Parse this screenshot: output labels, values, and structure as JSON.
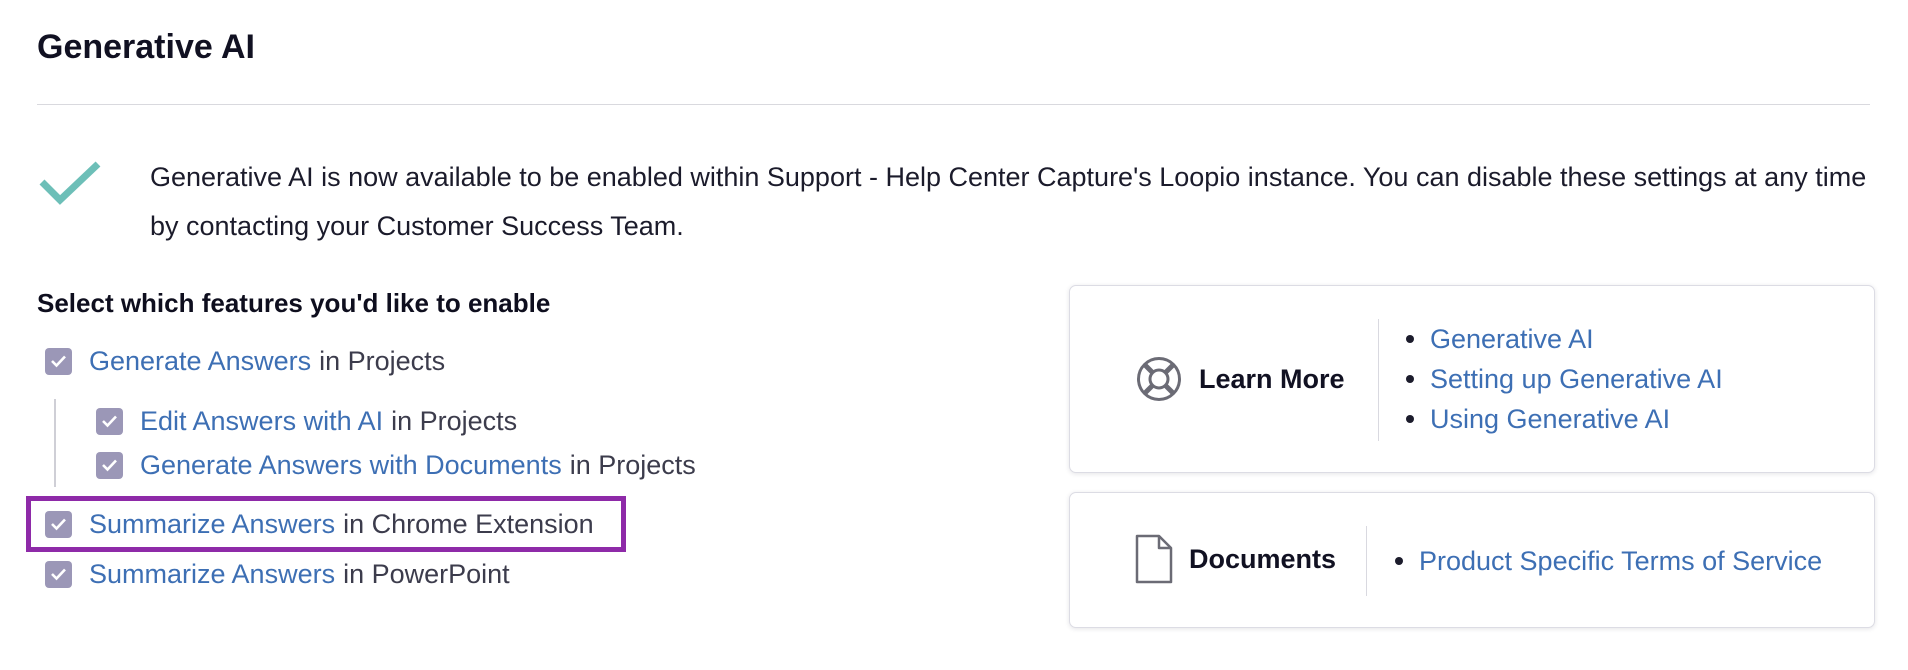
{
  "page": {
    "title": "Generative AI",
    "notice": "Generative AI is now available to be enabled within Support - Help Center Capture's Loopio instance. You can disable these settings at any time by contacting your Customer Success Team."
  },
  "features": {
    "title": "Select which features you'd like to enable",
    "items": [
      {
        "link": "Generate Answers",
        "context": "in Projects",
        "checked": true
      },
      {
        "link": "Edit Answers with AI",
        "context": "in Projects",
        "checked": true
      },
      {
        "link": "Generate Answers with Documents",
        "context": "in Projects",
        "checked": true
      },
      {
        "link": "Summarize Answers",
        "context": "in Chrome Extension",
        "checked": true
      },
      {
        "link": "Summarize Answers",
        "context": "in PowerPoint",
        "checked": true
      }
    ]
  },
  "learn_more": {
    "title": "Learn More",
    "icon": "lifebuoy-icon",
    "links": [
      "Generative AI",
      "Setting up Generative AI",
      "Using Generative AI"
    ]
  },
  "documents": {
    "title": "Documents",
    "icon": "document-icon",
    "links": [
      "Product Specific Terms of Service"
    ]
  },
  "colors": {
    "link": "#3d6fb4",
    "checkbox": "#9b97b7",
    "check_mark": "#6dbfb8",
    "highlight": "#8e2aa8"
  }
}
